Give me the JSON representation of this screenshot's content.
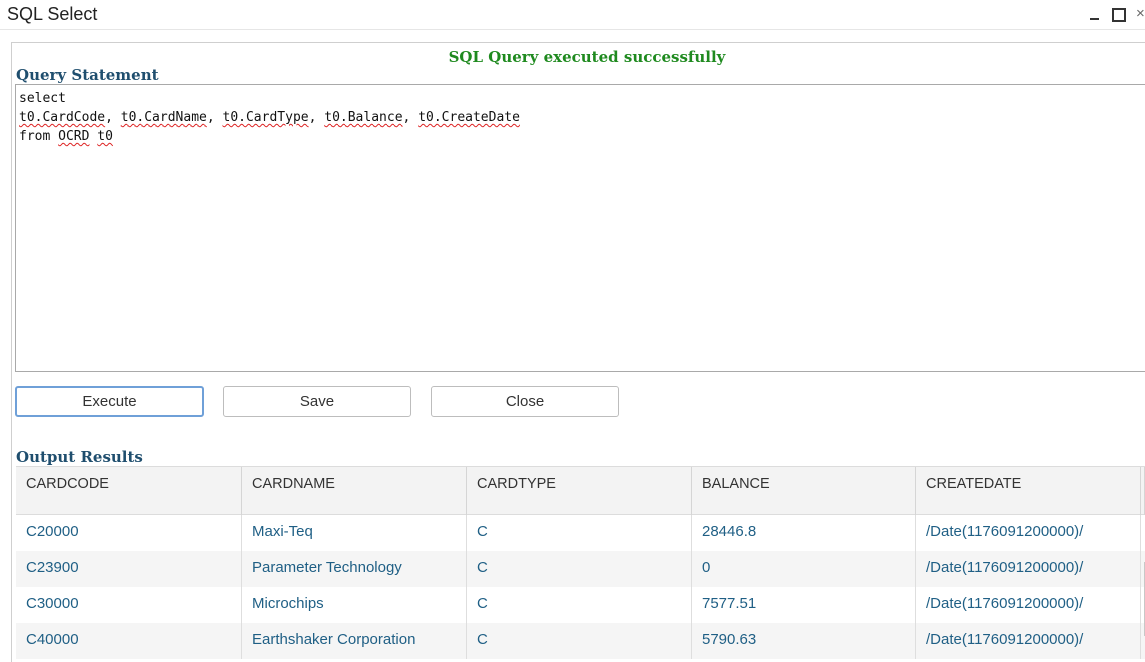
{
  "window": {
    "title": "SQL Select",
    "minimize_icon": "minimize-icon",
    "maximize_icon": "maximize-icon",
    "close_glyph": "×"
  },
  "status_message": "SQL Query executed successfully",
  "query": {
    "label": "Query Statement",
    "lines": [
      "select",
      "t0.CardCode, t0.CardName, t0.CardType, t0.Balance, t0.CreateDate",
      "from OCRD t0"
    ]
  },
  "buttons": {
    "execute": "Execute",
    "save": "Save",
    "close": "Close"
  },
  "output": {
    "label": "Output Results",
    "columns": [
      "CARDCODE",
      "CARDNAME",
      "CARDTYPE",
      "BALANCE",
      "CREATEDATE"
    ],
    "rows": [
      [
        "C20000",
        "Maxi-Teq",
        "C",
        "28446.8",
        "/Date(1176091200000)/"
      ],
      [
        "C23900",
        "Parameter Technology",
        "C",
        "0",
        "/Date(1176091200000)/"
      ],
      [
        "C30000",
        "Microchips",
        "C",
        "7577.51",
        "/Date(1176091200000)/"
      ],
      [
        "C40000",
        "Earthshaker Corporation",
        "C",
        "5790.63",
        "/Date(1176091200000)/"
      ]
    ]
  },
  "colors": {
    "status_green": "#1f8a1f",
    "label_blue": "#1f4e6e",
    "cell_text": "#1f5f85",
    "focus_border": "#6fa0d8"
  }
}
